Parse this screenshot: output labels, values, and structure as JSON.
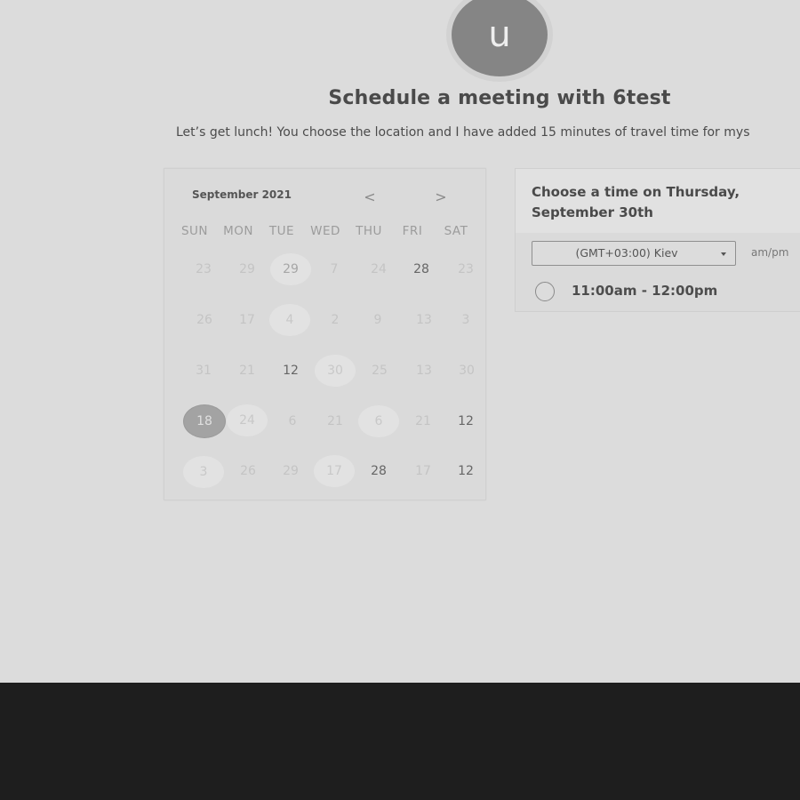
{
  "host": {
    "avatar_initial": "u",
    "title": "Schedule a meeting with 6test",
    "description": "Let’s get lunch! You choose the location and I have added 15 minutes of travel time for mys"
  },
  "calendar": {
    "month_label": "September 2021",
    "prev_icon": "<",
    "next_icon": ">",
    "weekdays": [
      "SUN",
      "MON",
      "TUE",
      "WED",
      "THU",
      "FRI",
      "SAT"
    ],
    "weeks": [
      [
        "23",
        "29",
        "29",
        "7",
        "24",
        "28",
        "23"
      ],
      [
        "26",
        "17",
        "4",
        "2",
        "9",
        "13",
        "3"
      ],
      [
        "31",
        "21",
        "12",
        "30",
        "25",
        "13",
        "30"
      ],
      [
        "18",
        "24",
        "6",
        "21",
        "6",
        "21",
        "12"
      ],
      [
        "3",
        "26",
        "29",
        "17",
        "28",
        "17",
        "12"
      ]
    ],
    "selected_day": "18"
  },
  "time_panel": {
    "title": "Choose a time on Thursday, September 30th",
    "timezone": "(GMT+03:00) Kiev",
    "format_toggle": "am/pm",
    "slots": [
      "11:00am - 12:00pm"
    ]
  }
}
